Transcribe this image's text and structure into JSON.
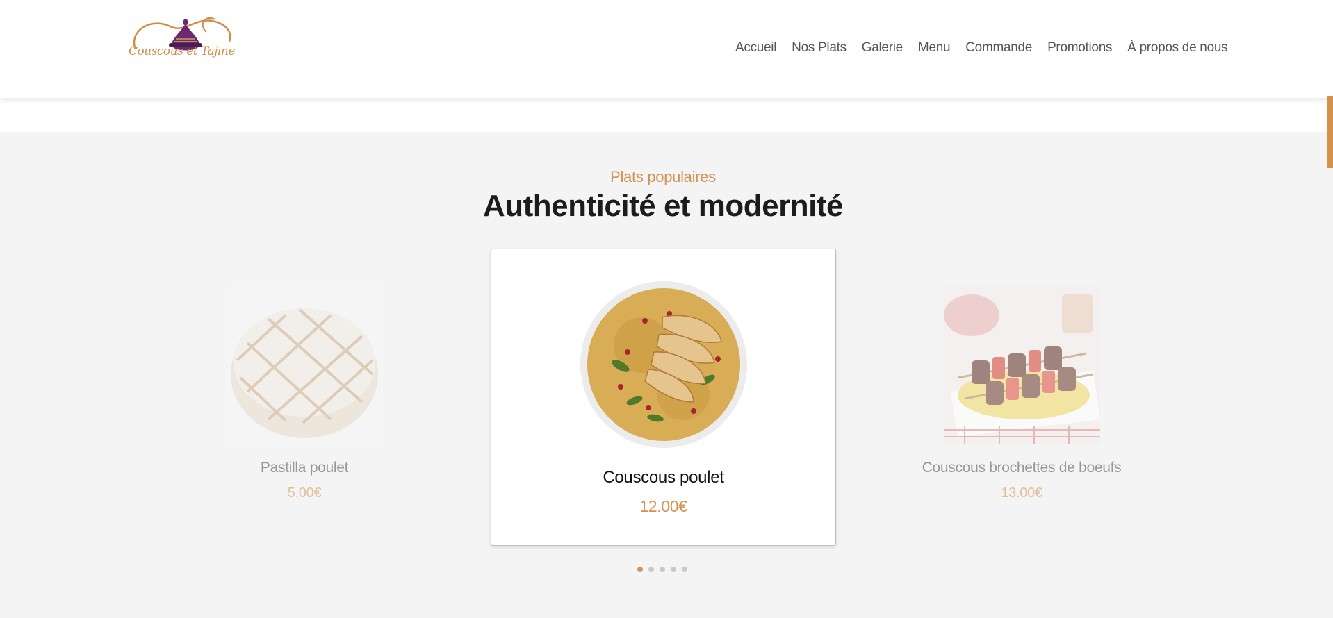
{
  "brand": {
    "logo_text": "Couscous et Tajine"
  },
  "nav": {
    "items": [
      {
        "label": "Accueil"
      },
      {
        "label": "Nos Plats"
      },
      {
        "label": "Galerie"
      },
      {
        "label": "Menu"
      },
      {
        "label": "Commande"
      },
      {
        "label": "Promotions"
      },
      {
        "label": "À propos de nous"
      }
    ]
  },
  "section": {
    "eyebrow": "Plats populaires",
    "title": "Authenticité et modernité"
  },
  "carousel": {
    "items": [
      {
        "name": "Pastilla poulet",
        "price": "5.00€"
      },
      {
        "name": "Couscous poulet",
        "price": "12.00€"
      },
      {
        "name": "Couscous brochettes de boeufs",
        "price": "13.00€"
      }
    ],
    "dot_count": 5,
    "active_dot": 1
  },
  "colors": {
    "accent": "#d4924f",
    "background": "#f4f4f4",
    "header_bg": "#ffffff"
  },
  "icons": {
    "logo": "tajine-pot-icon"
  }
}
